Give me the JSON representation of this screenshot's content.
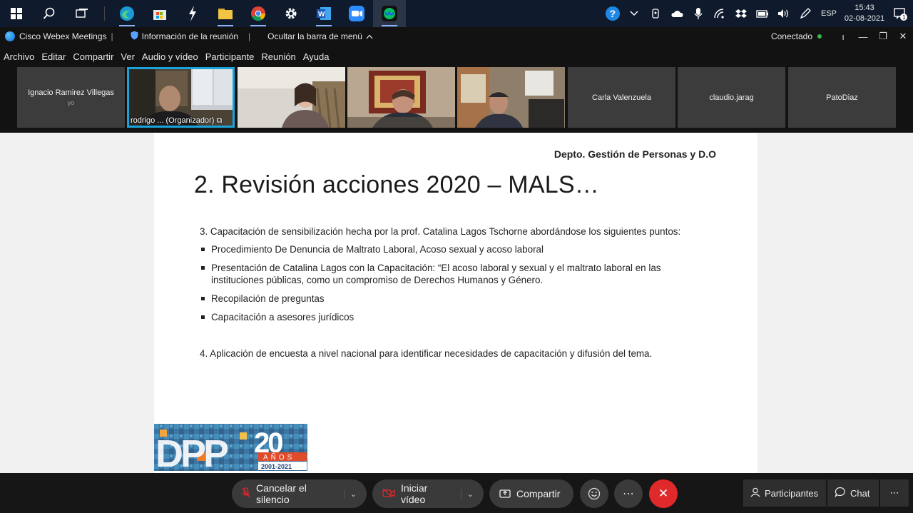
{
  "taskbar": {
    "clock_time": "15:43",
    "clock_date": "02-08-2021",
    "language": "ESP",
    "notification_count": "1"
  },
  "titlebar": {
    "app_name": "Cisco Webex Meetings",
    "meeting_info": "Información de la reunión",
    "hide_menu": "Ocultar la barra de menú",
    "status": "Conectado"
  },
  "menu": [
    "Archivo",
    "Editar",
    "Compartir",
    "Ver",
    "Audio y vídeo",
    "Participante",
    "Reunión",
    "Ayuda"
  ],
  "participants": [
    {
      "name": "Ignacio Ramirez Villegas",
      "sub": "yo",
      "video": false
    },
    {
      "caption": "rodrigo ...  (Organizador)",
      "video": true,
      "active": true
    },
    {
      "video": true
    },
    {
      "video": true
    },
    {
      "video": true
    },
    {
      "name": "Carla Valenzuela",
      "video": false
    },
    {
      "name": "claudio.jarag",
      "video": false
    },
    {
      "name": "PatoDiaz",
      "video": false
    }
  ],
  "slide": {
    "dept": "Depto. Gestión de Personas y D.O",
    "title": "2.  Revisión acciones 2020 – MALS…",
    "point3": "3. Capacitación de sensibilización hecha por la prof. Catalina Lagos Tschorne abordándose  los siguientes puntos:",
    "bullets": [
      "Procedimiento De Denuncia de Maltrato Laboral, Acoso sexual y acoso laboral",
      "Presentación de Catalina Lagos con la Capacitación: “El acoso laboral y sexual y el maltrato laboral en las instituciones públicas, como un compromiso de Derechos Humanos y Género.",
      "Recopilación de preguntas",
      "Capacitación a asesores jurídicos"
    ],
    "point4": "4. Aplicación de encuesta a nivel nacional para identificar necesidades de capacitación y difusión del tema.",
    "logo": {
      "letters": "DPP",
      "number": "20",
      "anos": "AÑOS",
      "years": "2001-2021"
    }
  },
  "controls": {
    "unmute": "Cancelar el silencio",
    "start_video": "Iniciar vídeo",
    "share": "Compartir",
    "participants": "Participantes",
    "chat": "Chat"
  }
}
